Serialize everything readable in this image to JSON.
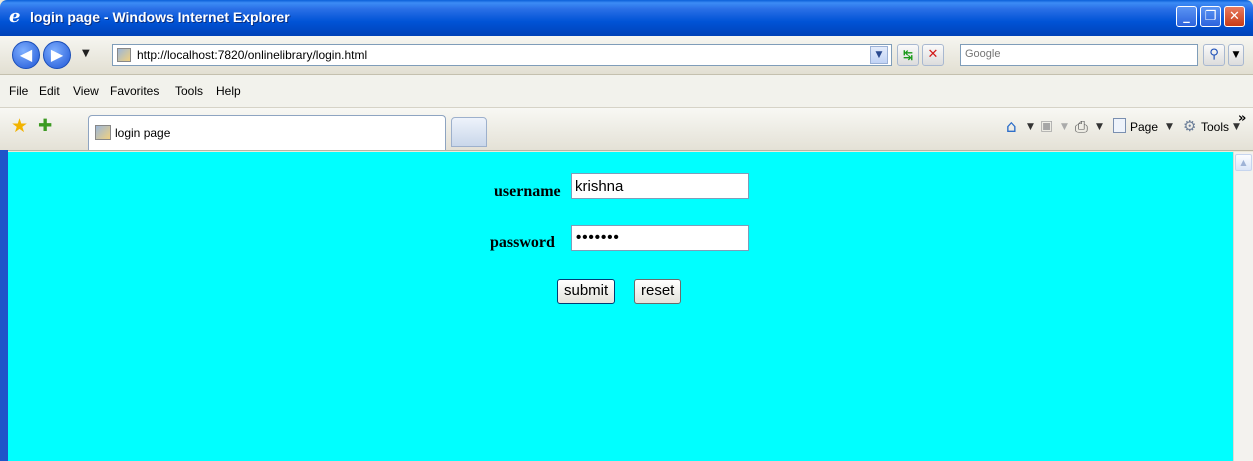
{
  "window": {
    "title": "login page - Windows Internet Explorer",
    "ie_icon": "e",
    "minimize_glyph": "_",
    "maximize_glyph": "❐",
    "close_glyph": "✕"
  },
  "address_bar": {
    "url": "http://localhost:7820/onlinelibrary/login.html",
    "back_glyph": "◀",
    "forward_glyph": "▶",
    "dropdown_glyph": "▼",
    "refresh_glyph": "↹",
    "stop_glyph": "✕"
  },
  "search": {
    "placeholder": "Google",
    "button_glyph": "⚲",
    "dropdown_glyph": "▼"
  },
  "menu": [
    "File",
    "Edit",
    "View",
    "Favorites",
    "Tools",
    "Help"
  ],
  "tabs": {
    "active_label": "login page"
  },
  "command_bar": {
    "favorites_glyph": "★",
    "add_favorites_glyph": "✚",
    "home_glyph": "⌂",
    "feeds_glyph": "▣",
    "print_glyph": "⎙",
    "dropdown_glyph": "▼",
    "page_label": "Page",
    "tools_label": "Tools",
    "tools_glyph": "⚙",
    "more_glyph": "»"
  },
  "page": {
    "background_color": "#00ffff",
    "username_label": "username",
    "username_value": "krishna",
    "password_label": "password",
    "password_mask": "•••••••",
    "submit_label": "submit",
    "reset_label": "reset"
  },
  "scrollbar": {
    "up_glyph": "▲"
  }
}
